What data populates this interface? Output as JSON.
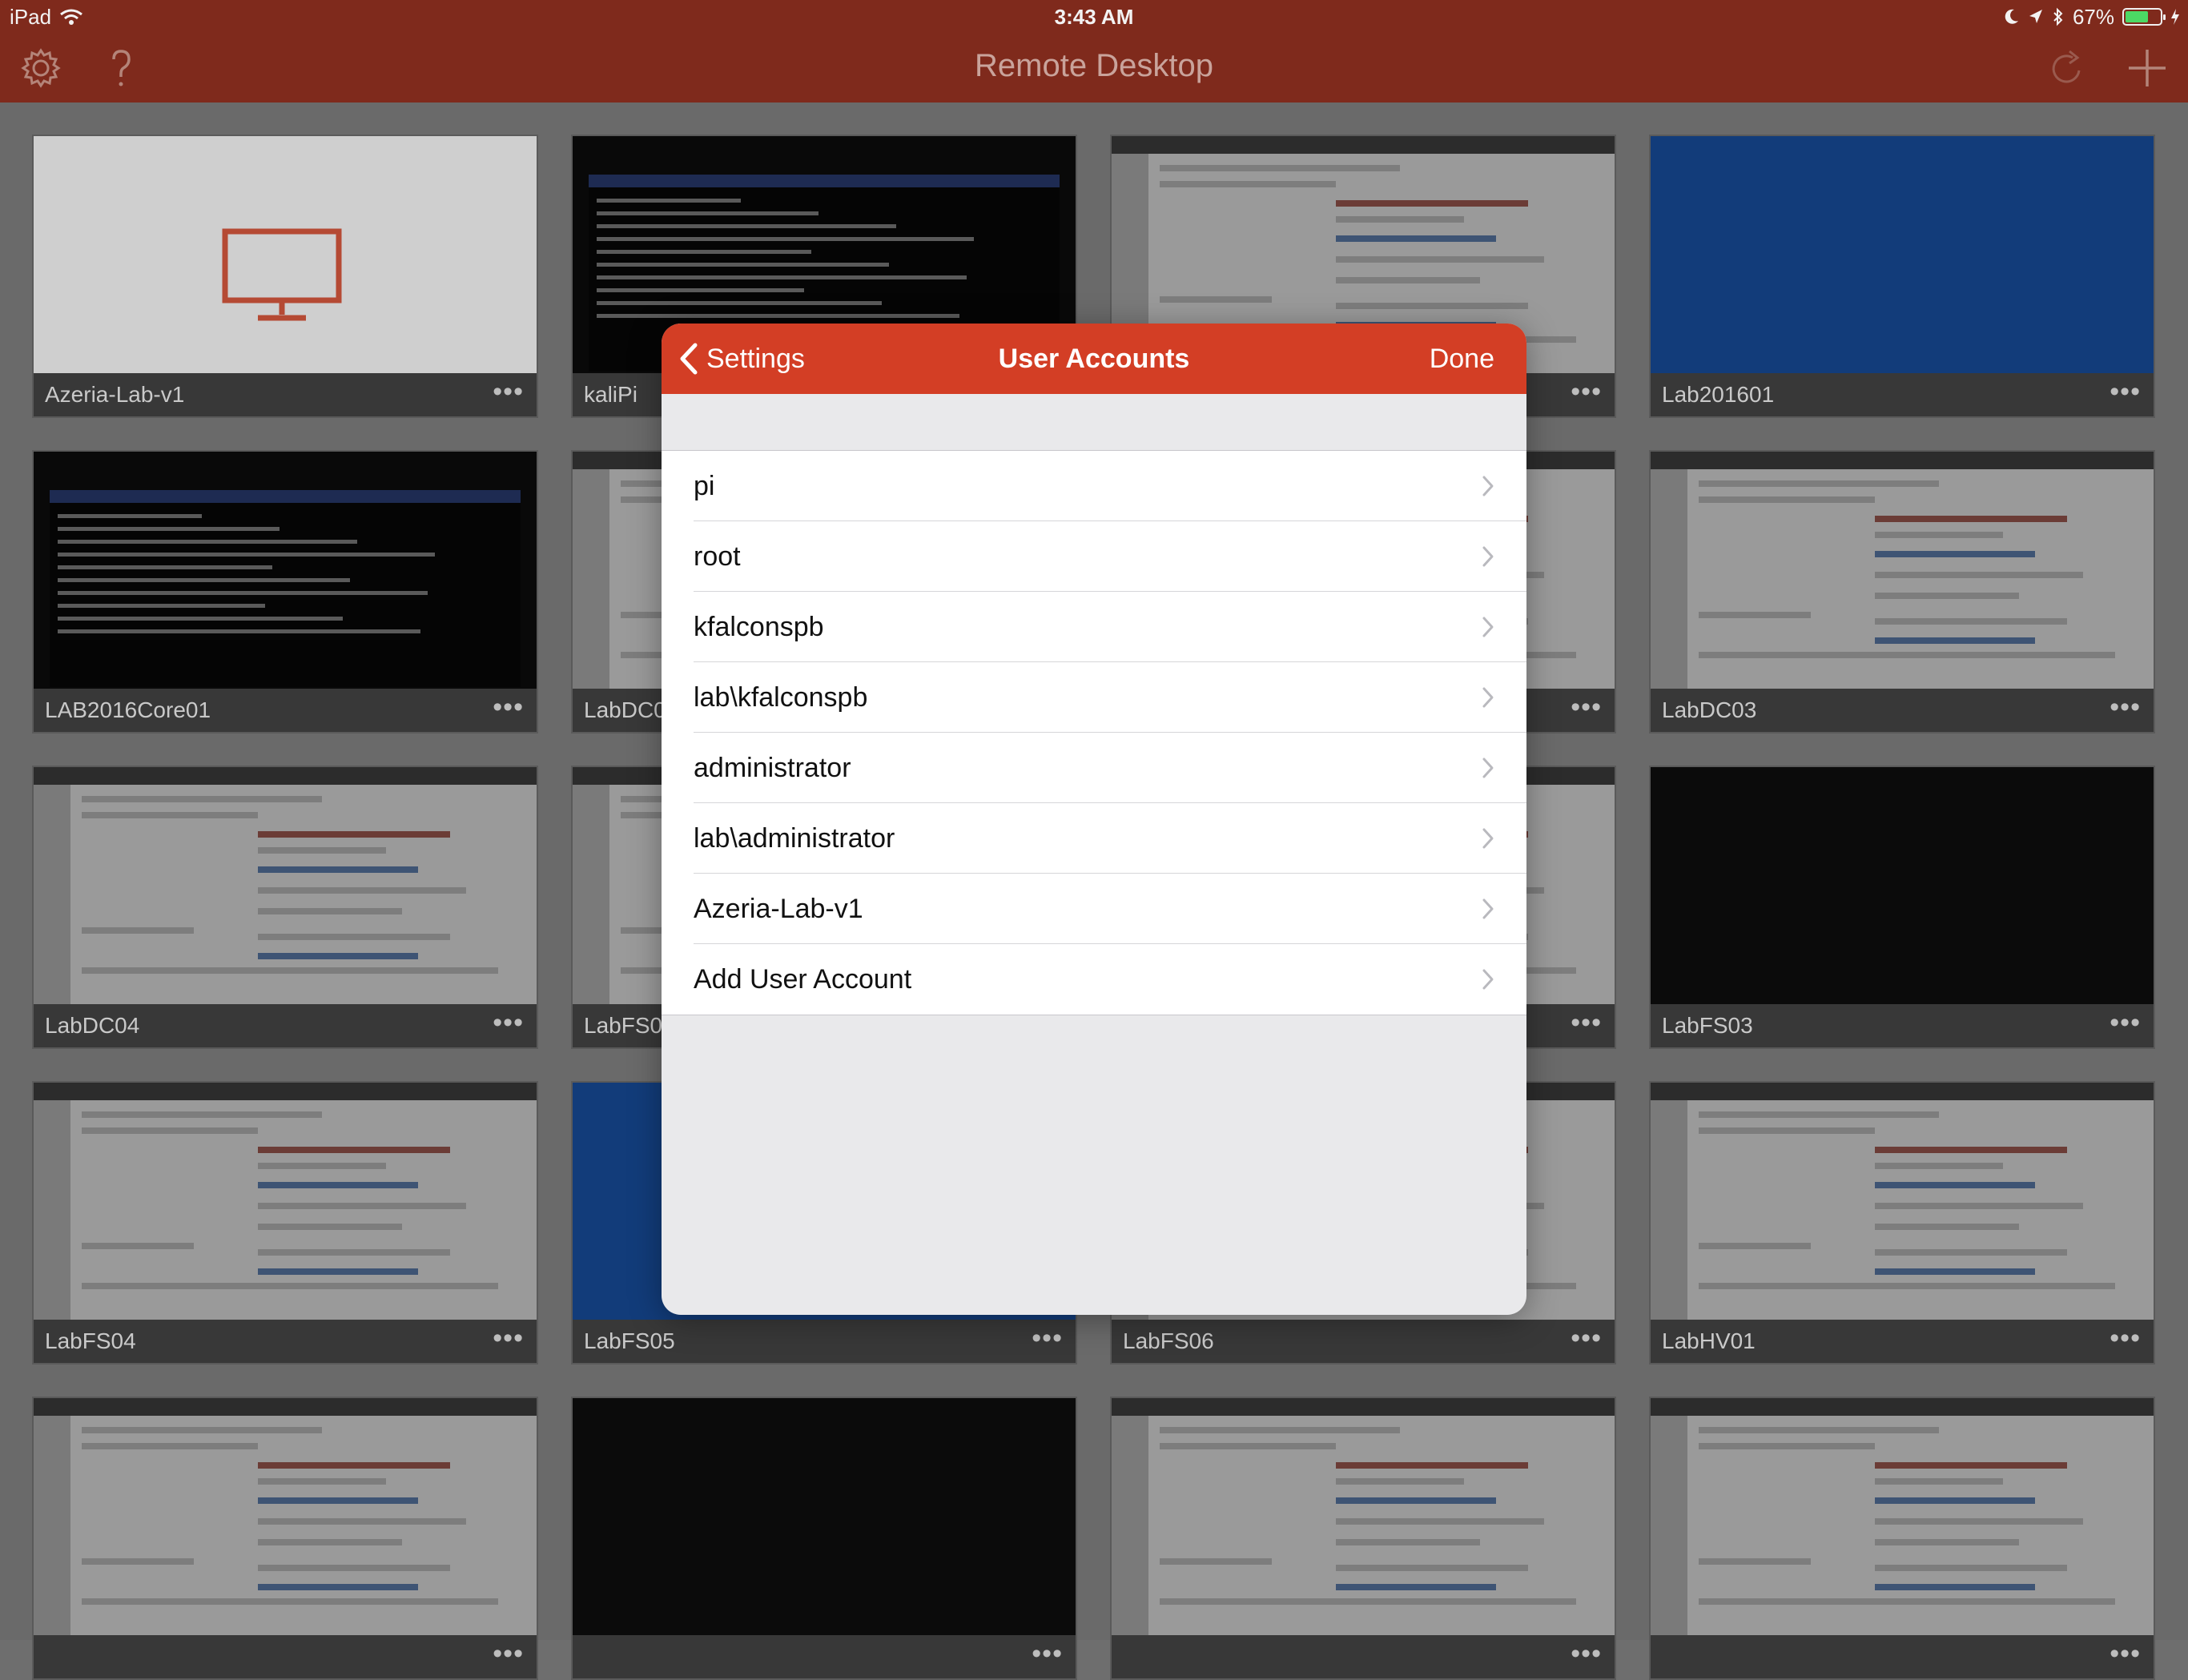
{
  "status_bar": {
    "device": "iPad",
    "time": "3:43 AM",
    "battery": "67%",
    "battery_level": 0.67
  },
  "nav": {
    "title": "Remote Desktop",
    "left_icons": [
      "gear-icon",
      "question-icon"
    ],
    "right_icons": [
      "refresh-icon",
      "plus-icon"
    ]
  },
  "tiles": [
    {
      "name": "Azeria-Lab-v1",
      "thumb": "white"
    },
    {
      "name": "kaliPi",
      "thumb": "console"
    },
    {
      "name": "",
      "thumb": "win"
    },
    {
      "name": "Lab201601",
      "thumb": "blue"
    },
    {
      "name": "LAB2016Core01",
      "thumb": "console"
    },
    {
      "name": "LabDC0",
      "thumb": "win"
    },
    {
      "name": "",
      "thumb": "win"
    },
    {
      "name": "LabDC03",
      "thumb": "win"
    },
    {
      "name": "LabDC04",
      "thumb": "win"
    },
    {
      "name": "LabFS0",
      "thumb": "win"
    },
    {
      "name": "",
      "thumb": "win"
    },
    {
      "name": "LabFS03",
      "thumb": "black"
    },
    {
      "name": "LabFS04",
      "thumb": "win"
    },
    {
      "name": "LabFS05",
      "thumb": "blue"
    },
    {
      "name": "LabFS06",
      "thumb": "win"
    },
    {
      "name": "LabHV01",
      "thumb": "win"
    },
    {
      "name": "",
      "thumb": "win"
    },
    {
      "name": "",
      "thumb": "black"
    },
    {
      "name": "",
      "thumb": "win"
    },
    {
      "name": "",
      "thumb": "win"
    }
  ],
  "more_label": "•••",
  "modal": {
    "back_label": "Settings",
    "title": "User Accounts",
    "done_label": "Done",
    "accounts": [
      "pi",
      "root",
      "kfalconspb",
      "lab\\kfalconspb",
      "administrator",
      "lab\\administrator",
      "Azeria-Lab-v1",
      "Add User Account"
    ]
  },
  "colors": {
    "nav_background": "#7f2a1c",
    "modal_header": "#d33e25",
    "accent_red": "#d33e25"
  }
}
